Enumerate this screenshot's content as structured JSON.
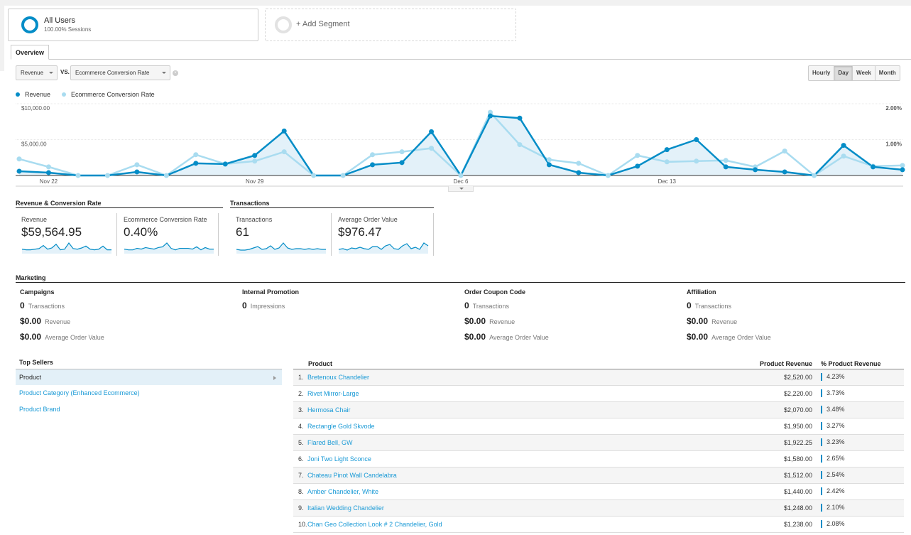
{
  "segments": {
    "all_users": {
      "title": "All Users",
      "subtitle": "100.00% Sessions"
    },
    "add_segment": {
      "label": "+ Add Segment"
    }
  },
  "tabs": [
    {
      "label": "Overview",
      "active": true
    }
  ],
  "metric_selector": {
    "primary": "Revenue",
    "vs_label": "VS.",
    "secondary": "Ecommerce Conversion Rate",
    "clear_icon": "close-circle-icon"
  },
  "granularity": [
    {
      "label": "Hourly",
      "active": false
    },
    {
      "label": "Day",
      "active": true
    },
    {
      "label": "Week",
      "active": false
    },
    {
      "label": "Month",
      "active": false
    }
  ],
  "colors": {
    "revenue": "#058dc7",
    "conversion": "#a9dcf0",
    "area_fill": "#e3f1f9",
    "link": "#1a9ad6"
  },
  "chart_data": {
    "type": "line",
    "title": "",
    "legend_position": "top-left",
    "x": [
      "Nov 21",
      "Nov 22",
      "Nov 23",
      "Nov 24",
      "Nov 25",
      "Nov 26",
      "Nov 27",
      "Nov 28",
      "Nov 29",
      "Nov 30",
      "Dec 1",
      "Dec 2",
      "Dec 3",
      "Dec 4",
      "Dec 5",
      "Dec 6",
      "Dec 7",
      "Dec 8",
      "Dec 9",
      "Dec 10",
      "Dec 11",
      "Dec 12",
      "Dec 13",
      "Dec 14",
      "Dec 15",
      "Dec 16",
      "Dec 17",
      "Dec 18",
      "Dec 19",
      "Dec 20",
      "Dec 21"
    ],
    "x_tick_labels": [
      "Nov 22",
      "Nov 29",
      "Dec 6",
      "Dec 13"
    ],
    "left_axis": {
      "label": "Revenue",
      "ticks": [
        "$5,000.00",
        "$10,000.00"
      ],
      "ylim": [
        0,
        10000
      ]
    },
    "right_axis": {
      "label": "Ecommerce Conversion Rate",
      "ticks": [
        "1.00%",
        "2.00%"
      ],
      "ylim": [
        0,
        2.0
      ]
    },
    "series": [
      {
        "name": "Revenue",
        "axis": "left",
        "values": [
          600,
          400,
          0,
          0,
          500,
          0,
          1700,
          1600,
          2800,
          6200,
          0,
          0,
          1500,
          1800,
          6100,
          0,
          8300,
          8000,
          1500,
          400,
          0,
          1300,
          3600,
          5000,
          1200,
          800,
          500,
          0,
          4200,
          1200,
          800
        ]
      },
      {
        "name": "Ecommerce Conversion Rate",
        "axis": "right",
        "values": [
          0.46,
          0.24,
          0,
          0,
          0.3,
          0,
          0.58,
          0.32,
          0.4,
          0.66,
          0,
          0,
          0.58,
          0.66,
          0.76,
          0,
          1.76,
          0.86,
          0.44,
          0.34,
          0,
          0.56,
          0.38,
          0.4,
          0.42,
          0.24,
          0.68,
          0,
          0.54,
          0.26,
          0.28
        ]
      }
    ],
    "grid": true
  },
  "scorecards": {
    "groups": [
      {
        "title": "Revenue & Conversion Rate",
        "cards": [
          {
            "label": "Revenue",
            "value": "$59,564.95",
            "spark": [
              6,
              5,
              5,
              6,
              7,
              12,
              6,
              8,
              14,
              5,
              6,
              16,
              7,
              6,
              8,
              11,
              6,
              5,
              6,
              11,
              5,
              5
            ]
          },
          {
            "label": "Ecommerce Conversion Rate",
            "value": "0.40%",
            "spark": [
              5,
              4,
              4,
              6,
              5,
              7,
              6,
              5,
              7,
              8,
              13,
              6,
              4,
              6,
              6,
              6,
              5,
              8,
              4,
              7,
              5,
              5
            ]
          }
        ]
      },
      {
        "title": "Transactions",
        "cards": [
          {
            "label": "Transactions",
            "value": "61",
            "spark": [
              5,
              4,
              4,
              5,
              7,
              9,
              5,
              6,
              10,
              5,
              7,
              14,
              7,
              5,
              6,
              6,
              5,
              6,
              5,
              6,
              5,
              5
            ]
          },
          {
            "label": "Average Order Value",
            "value": "$976.47",
            "spark": [
              5,
              6,
              4,
              7,
              6,
              8,
              6,
              5,
              9,
              9,
              5,
              10,
              12,
              6,
              5,
              10,
              13,
              6,
              8,
              5,
              14,
              10
            ]
          }
        ]
      }
    ]
  },
  "marketing": {
    "title": "Marketing",
    "columns": [
      {
        "title": "Campaigns",
        "rows": [
          {
            "value": "0",
            "label": "Transactions"
          },
          {
            "value": "$0.00",
            "label": "Revenue"
          },
          {
            "value": "$0.00",
            "label": "Average Order Value"
          }
        ]
      },
      {
        "title": "Internal Promotion",
        "rows": [
          {
            "value": "0",
            "label": "Impressions"
          }
        ]
      },
      {
        "title": "Order Coupon Code",
        "rows": [
          {
            "value": "0",
            "label": "Transactions"
          },
          {
            "value": "$0.00",
            "label": "Revenue"
          },
          {
            "value": "$0.00",
            "label": "Average Order Value"
          }
        ]
      },
      {
        "title": "Affiliation",
        "rows": [
          {
            "value": "0",
            "label": "Transactions"
          },
          {
            "value": "$0.00",
            "label": "Revenue"
          },
          {
            "value": "$0.00",
            "label": "Average Order Value"
          }
        ]
      }
    ]
  },
  "top_sellers": {
    "title": "Top Sellers",
    "items": [
      {
        "label": "Product",
        "active": true
      },
      {
        "label": "Product Category (Enhanced Ecommerce)",
        "active": false
      },
      {
        "label": "Product Brand",
        "active": false
      }
    ]
  },
  "product_table": {
    "headers": {
      "product": "Product",
      "revenue": "Product Revenue",
      "pct": "% Product Revenue"
    },
    "rows": [
      {
        "rank": "1.",
        "product": "Bretenoux Chandelier",
        "revenue": "$2,520.00",
        "pct": "4.23%"
      },
      {
        "rank": "2.",
        "product": "Rivet Mirror-Large",
        "revenue": "$2,220.00",
        "pct": "3.73%"
      },
      {
        "rank": "3.",
        "product": "Hermosa Chair",
        "revenue": "$2,070.00",
        "pct": "3.48%"
      },
      {
        "rank": "4.",
        "product": "Rectangle Gold Skvode",
        "revenue": "$1,950.00",
        "pct": "3.27%"
      },
      {
        "rank": "5.",
        "product": "Flared Bell, GW",
        "revenue": "$1,922.25",
        "pct": "3.23%"
      },
      {
        "rank": "6.",
        "product": "Joni Two Light Sconce",
        "revenue": "$1,580.00",
        "pct": "2.65%"
      },
      {
        "rank": "7.",
        "product": "Chateau Pinot Wall Candelabra",
        "revenue": "$1,512.00",
        "pct": "2.54%"
      },
      {
        "rank": "8.",
        "product": "Amber Chandelier, White",
        "revenue": "$1,440.00",
        "pct": "2.42%"
      },
      {
        "rank": "9.",
        "product": "Italian Wedding Chandelier",
        "revenue": "$1,248.00",
        "pct": "2.10%"
      },
      {
        "rank": "10.",
        "product": "Chan Geo Collection Look # 2 Chandelier, Gold",
        "revenue": "$1,238.00",
        "pct": "2.08%"
      }
    ]
  }
}
